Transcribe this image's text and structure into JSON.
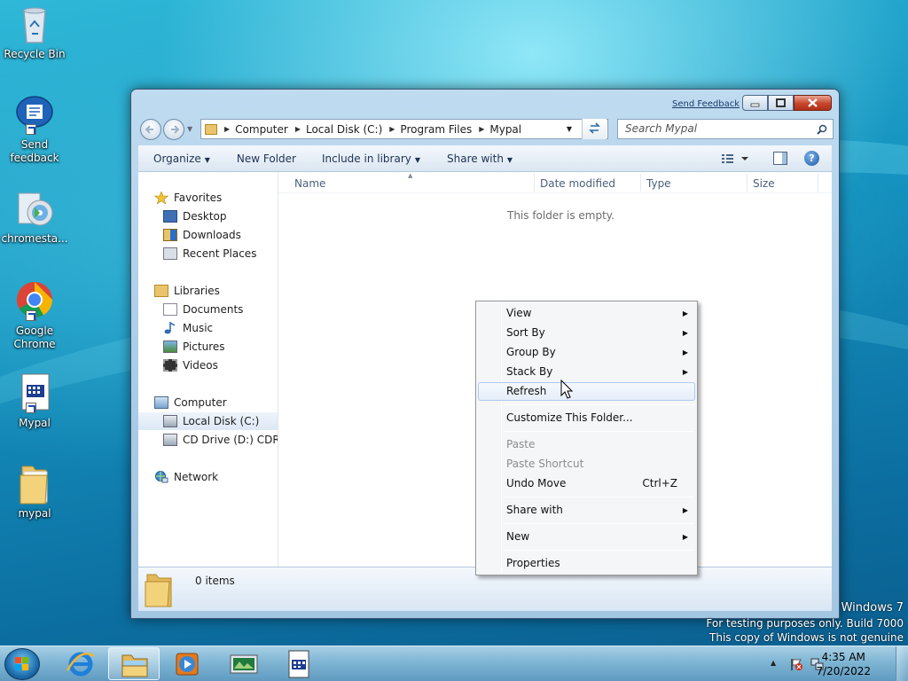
{
  "desktop": {
    "icons": [
      {
        "label": "Recycle Bin"
      },
      {
        "label": "Send feedback"
      },
      {
        "label": "chromesta..."
      },
      {
        "label": "Google Chrome"
      },
      {
        "label": "Mypal"
      },
      {
        "label": "mypal"
      }
    ]
  },
  "window": {
    "send_feedback": "Send Feedback",
    "breadcrumbs": [
      "Computer",
      "Local Disk (C:)",
      "Program Files",
      "Mypal"
    ],
    "search_placeholder": "Search Mypal",
    "toolbar": {
      "organize": "Organize",
      "new_folder": "New Folder",
      "include_in_library": "Include in library",
      "share_with": "Share with"
    },
    "nav": {
      "favorites": "Favorites",
      "favorites_items": [
        "Desktop",
        "Downloads",
        "Recent Places"
      ],
      "libraries": "Libraries",
      "libraries_items": [
        "Documents",
        "Music",
        "Pictures",
        "Videos"
      ],
      "computer": "Computer",
      "computer_items": [
        "Local Disk (C:)",
        "CD Drive (D:) CDROM"
      ],
      "network": "Network"
    },
    "columns": [
      "Name",
      "Date modified",
      "Type",
      "Size"
    ],
    "empty_text": "This folder is empty.",
    "item_count": "0 items"
  },
  "context_menu": {
    "items": [
      {
        "label": "View",
        "submenu": true
      },
      {
        "label": "Sort By",
        "submenu": true
      },
      {
        "label": "Group By",
        "submenu": true
      },
      {
        "label": "Stack By",
        "submenu": true
      },
      {
        "label": "Refresh",
        "highlighted": true
      },
      {
        "label": "Customize This Folder..."
      },
      {
        "label": "Paste",
        "disabled": true
      },
      {
        "label": "Paste Shortcut",
        "disabled": true
      },
      {
        "label": "Undo Move",
        "shortcut": "Ctrl+Z"
      },
      {
        "label": "Share with",
        "submenu": true
      },
      {
        "label": "New",
        "submenu": true
      },
      {
        "label": "Properties"
      }
    ]
  },
  "taskbar": {
    "clock_time": "4:35 AM",
    "clock_date": "7/20/2022"
  },
  "watermark": {
    "line1": "Windows 7",
    "line2": "For testing purposes only. Build 7000",
    "line3": "This copy of Windows is not genuine"
  },
  "colors": {
    "menu_highlight": "#aecbf1",
    "taskbar": "#7fb5d4",
    "window_frame": "#a9cbe6"
  }
}
